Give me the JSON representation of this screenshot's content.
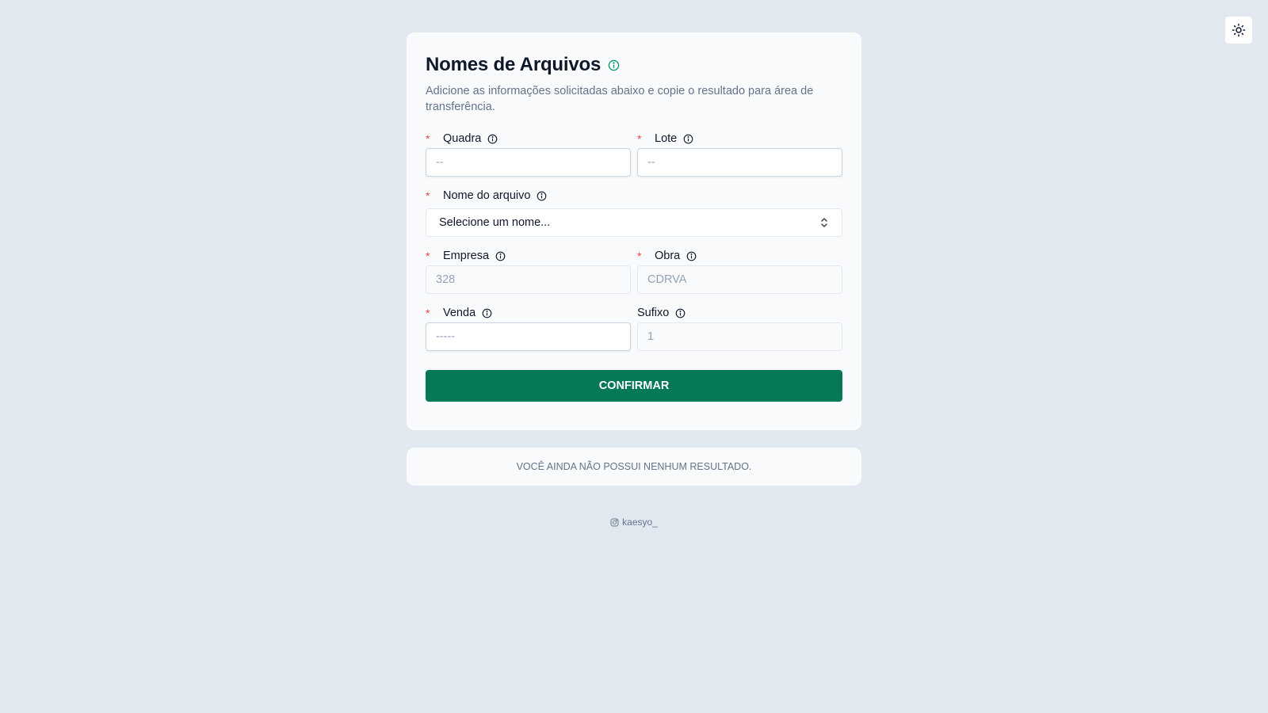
{
  "header": {
    "theme_toggle_icon": "sun-icon"
  },
  "form": {
    "title": "Nomes de Arquivos",
    "subtitle": "Adicione as informações solicitadas abaixo e copie o resultado para área de transferência.",
    "required_marker": "*",
    "fields": {
      "quadra": {
        "label": "Quadra",
        "placeholder": "--",
        "required": true
      },
      "lote": {
        "label": "Lote",
        "placeholder": "--",
        "required": true
      },
      "nome_arquivo": {
        "label": "Nome do arquivo",
        "selected": "Selecione um nome...",
        "required": true
      },
      "empresa": {
        "label": "Empresa",
        "placeholder": "328",
        "required": true
      },
      "obra": {
        "label": "Obra",
        "placeholder": "CDRVA",
        "required": true
      },
      "venda": {
        "label": "Venda",
        "placeholder": "-----",
        "required": true
      },
      "sufixo": {
        "label": "Sufixo",
        "placeholder": "1",
        "required": false
      }
    },
    "confirm_label": "CONFIRMAR",
    "accent_color": "#047857"
  },
  "result": {
    "empty_text": "VOCÊ AINDA NÃO POSSUI NENHUM RESULTADO."
  },
  "footer": {
    "icon": "instagram-icon",
    "handle": "kaesyo_"
  }
}
